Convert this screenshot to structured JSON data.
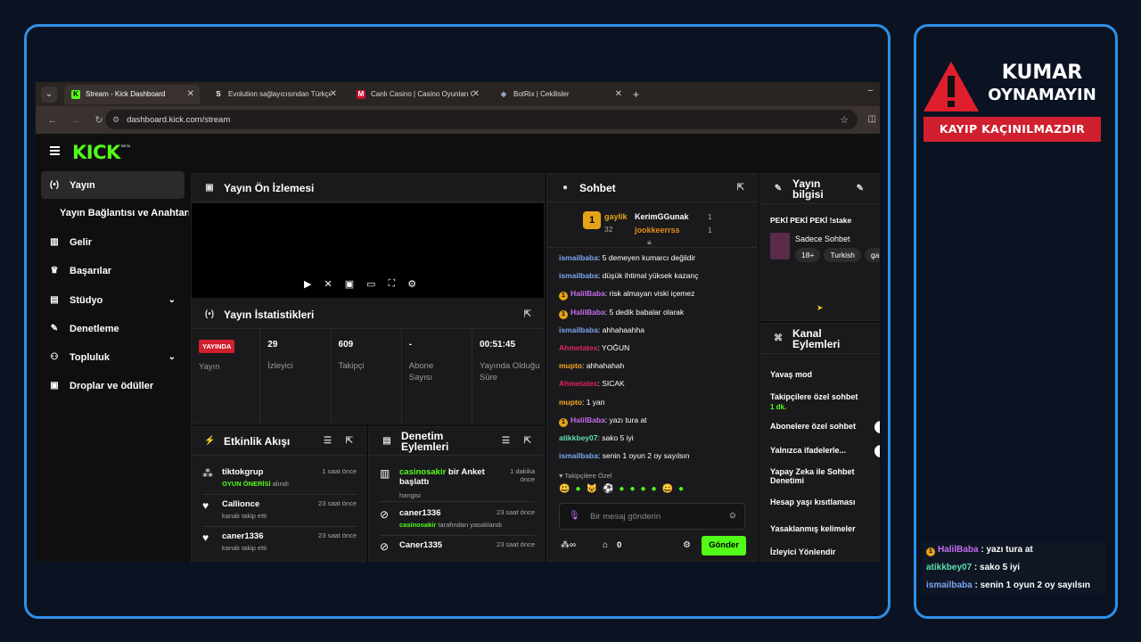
{
  "browser": {
    "tabs": [
      {
        "label": "Stream - Kick Dashboard",
        "icon": "kick-icon",
        "active": true
      },
      {
        "label": "Evolution sağlayıcısından Türkçe",
        "icon": "s-icon"
      },
      {
        "label": "Canlı Casino | Casino Oyunları Oyna",
        "icon": "m-icon"
      },
      {
        "label": "BotRix | Cekilisler",
        "icon": "botrix-icon"
      }
    ],
    "url": "dashboard.kick.com/stream"
  },
  "brand": {
    "logo": "KICK",
    "beta": "BETA",
    "accent": "#53fc18"
  },
  "sidebar": {
    "items": [
      {
        "label": "Yayın",
        "icon": "broadcast-icon"
      },
      {
        "label": "Yayın Bağlantısı ve Anahtarı"
      },
      {
        "label": "Gelir",
        "icon": "chart-icon"
      },
      {
        "label": "Başarılar",
        "icon": "trophy-icon"
      },
      {
        "label": "Stüdyo",
        "icon": "studio-icon"
      },
      {
        "label": "Denetleme",
        "icon": "wrench-icon"
      },
      {
        "label": "Topluluk",
        "icon": "people-icon"
      },
      {
        "label": "Droplar ve ödüller",
        "icon": "gift-icon"
      }
    ]
  },
  "preview": {
    "title": "Yayın Ön İzlemesi"
  },
  "stats": {
    "title": "Yayın İstatistikleri",
    "live_badge": "YAYINDA",
    "items": [
      {
        "value": "",
        "label": "Yayın"
      },
      {
        "value": "29",
        "label": "İzleyici"
      },
      {
        "value": "609",
        "label": "Takipçi"
      },
      {
        "value": "-",
        "label": "Abone Sayısı"
      },
      {
        "value": "00:51:45",
        "label": "Yayında Olduğu Süre"
      }
    ]
  },
  "activity": {
    "title": "Etkinlik Akışı",
    "events": [
      {
        "name": "tiktokgrup",
        "highlight": "OYUN ÖNERİSİ",
        "desc": " alındı",
        "time": "1 saat önce"
      },
      {
        "name": "Callionce",
        "desc": "kanalı takip etti",
        "time": "23 saat önce"
      },
      {
        "name": "caner1336",
        "desc": "kanalı takip etti",
        "time": "23 saat önce"
      }
    ]
  },
  "moderation": {
    "title": "Denetim Eylemleri",
    "actions": [
      {
        "name": "casinosakir",
        "rest": " bir Anket başlattı",
        "desc": "hangisi",
        "time": "1 dakika önce"
      },
      {
        "name": "caner1336",
        "by": "casinosakir",
        "desc": " tarafından yasaklandı",
        "time": "23 saat önce"
      },
      {
        "name": "Caner1335",
        "time": "23 saat önce"
      }
    ]
  },
  "chat": {
    "title": "Sohbet",
    "top": [
      {
        "name": "gaylik",
        "count": "32"
      },
      {
        "name": "KerimGGunak",
        "count": "1"
      },
      {
        "name": "jookkeerrss",
        "count": "1"
      }
    ],
    "messages": [
      {
        "user": "ismailbaba",
        "color": "#7aa7f2",
        "text": "5 demeyen kumarcı değildir",
        "badge": false
      },
      {
        "user": "ismailbaba",
        "color": "#7aa7f2",
        "text": "düşük ihtimal yüksek kazanç",
        "badge": false
      },
      {
        "user": "HalilBaba",
        "color": "#c56cf0",
        "text": "risk almayan viski içemez",
        "badge": true
      },
      {
        "user": "HalilBaba",
        "color": "#c56cf0",
        "text": "5 dedik babalar olarak",
        "badge": true
      },
      {
        "user": "ismailbaba",
        "color": "#7aa7f2",
        "text": "ahhahaahha",
        "badge": false
      },
      {
        "user": "Ahmetatex",
        "color": "#e0245e",
        "text": "YOĞUN",
        "badge": false
      },
      {
        "user": "mupto",
        "color": "#f5a623",
        "text": "ahhahahah",
        "badge": false
      },
      {
        "user": "Ahmetatex",
        "color": "#e0245e",
        "text": "SICAK",
        "badge": false
      },
      {
        "user": "mupto",
        "color": "#f5a623",
        "text": "1 yan",
        "badge": false
      },
      {
        "user": "HalilBaba",
        "color": "#c56cf0",
        "text": "yazı tura at",
        "badge": true
      },
      {
        "user": "atikkbey07",
        "color": "#5ee0b1",
        "text": "sako 5 iyi",
        "badge": false
      },
      {
        "user": "ismailbaba",
        "color": "#7aa7f2",
        "text": "senin 1 oyun 2 oy sayılsın",
        "badge": false
      }
    ],
    "followers_only": "Takipçilere Özel",
    "input_placeholder": "Bir mesaj gönderin",
    "points": "0",
    "send_label": "Gönder"
  },
  "stream_info": {
    "title": "Yayın bilgisi",
    "stream_title": "PEKİ PEKİ PEKİ !stake",
    "category": "Sadece Sohbet",
    "tags": [
      "18+",
      "Turkish",
      "ga"
    ]
  },
  "channel_actions": {
    "title": "Kanal Eylemleri",
    "items": [
      {
        "label": "Yavaş mod"
      },
      {
        "label": "Takipçilere özel sohbet",
        "sub": "1 dk."
      },
      {
        "label": "Abonelere özel sohbet"
      },
      {
        "label": "Yalnızca ifadelerle..."
      },
      {
        "label": "Yapay Zeka ile Sohbet Denetimi"
      },
      {
        "label": "Hesap yaşı kısıtlaması"
      },
      {
        "label": "Yasaklanmış kelimeler"
      },
      {
        "label": "İzleyici Yönlendir"
      }
    ]
  },
  "overlay": {
    "warning_line1": "KUMAR",
    "warning_line2": "OYNAMAYIN",
    "warning_sub": "KAYIP KAÇINILMAZDIR",
    "chat": [
      {
        "user": "HalilBaba",
        "color": "#c56cf0",
        "text": " : yazı tura at",
        "badge": true
      },
      {
        "user": "atikkbey07",
        "color": "#5ee0b1",
        "text": " : sako 5 iyi",
        "badge": false
      },
      {
        "user": "ismailbaba",
        "color": "#7aa7f2",
        "text": " : senin 1 oyun 2 oy sayılsın",
        "badge": false
      }
    ]
  }
}
